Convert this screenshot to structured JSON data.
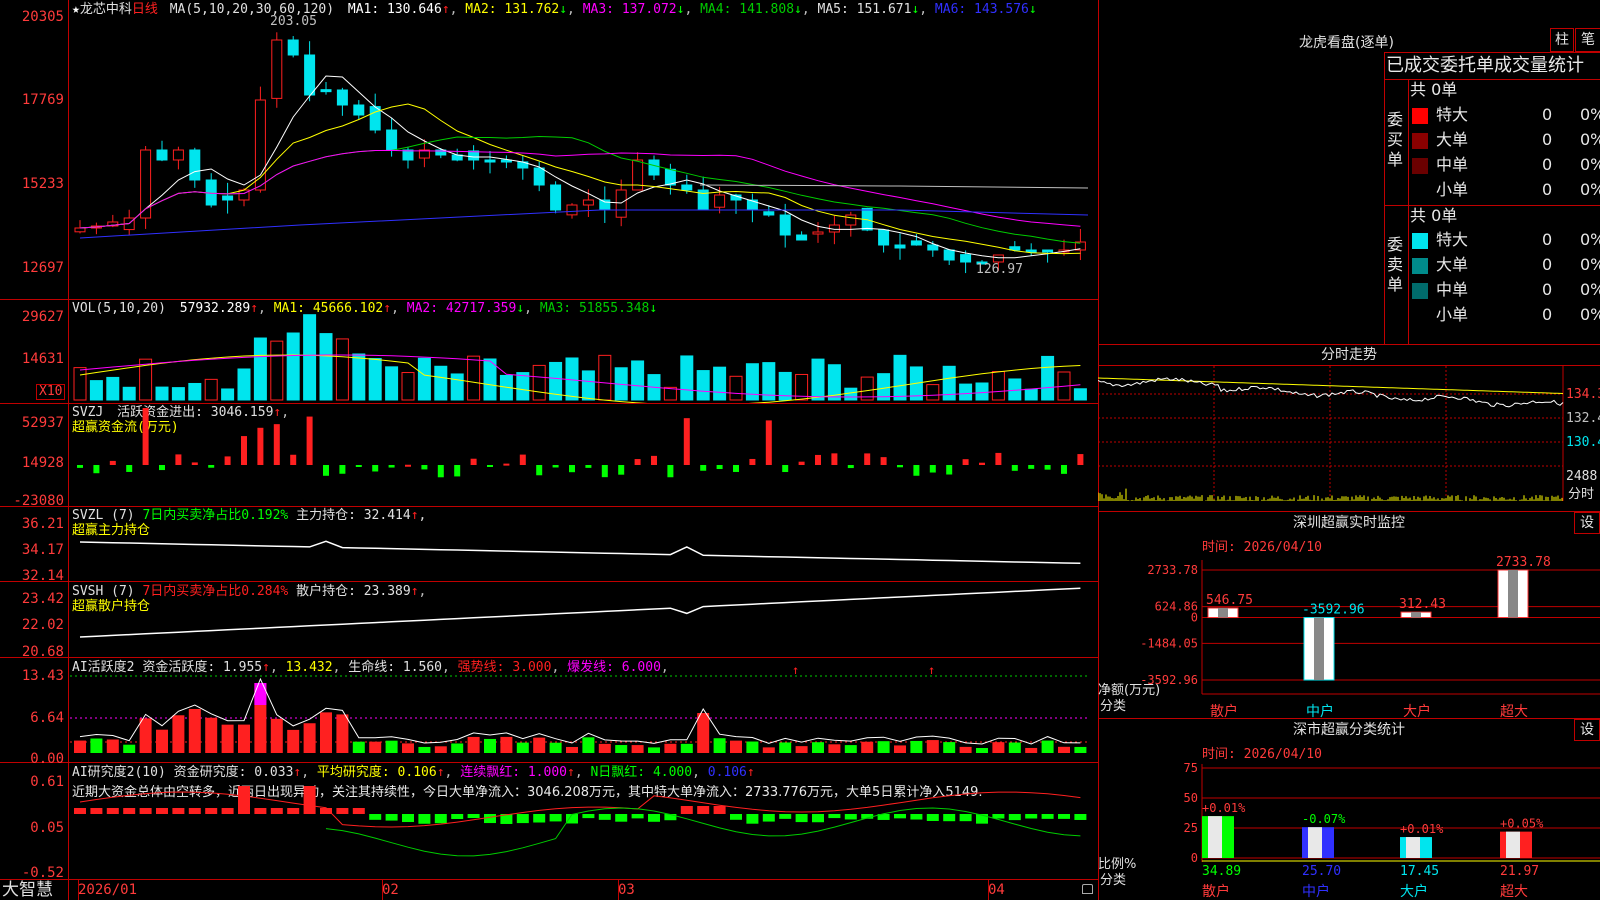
{
  "colors": {
    "up": "#ff2020",
    "down": "#00e5ee",
    "ma1": "#ffffff",
    "ma2": "#ffff00",
    "ma3": "#ff00ff",
    "ma4": "#00cc00",
    "ma5": "#c0c0c0",
    "ma6": "#3030ff",
    "green": "#00ff00",
    "frame": "#c00000"
  },
  "main": {
    "header": {
      "star": "★",
      "name": "龙芯中科",
      "period": "日线",
      "ma_params": "MA(5,10,20,30,60,120)",
      "ma1": "MA1: 130.646",
      "ma2": "MA2: 131.762",
      "ma3": "MA3: 137.072",
      "ma4": "MA4: 141.808",
      "ma5": "MA5: 151.671",
      "ma6": "MA6: 143.576",
      "up_arrow": "↑",
      "down_arrow": "↓"
    },
    "yticks": [
      "20305",
      "17769",
      "15233",
      "12697"
    ],
    "high_label": "203.05",
    "low_label": "126.97"
  },
  "vol": {
    "header": {
      "params": "VOL(5,10,20)",
      "value": "57932.289",
      "ma1": "MA1: 45666.102",
      "ma2": "MA2: 42717.359",
      "ma3": "MA3: 51855.348"
    },
    "yticks": [
      "29627",
      "14631"
    ],
    "unit": "X10"
  },
  "svzj": {
    "header": {
      "name": "SVZJ",
      "label": "活跃资金进出: 3046.159",
      "sub": "超赢资金流(万元)"
    },
    "yticks": [
      "52937",
      "14928",
      "-23080"
    ]
  },
  "svzl": {
    "header": {
      "name": "SVZL (7)",
      "ratio": "7日内买卖净占比0.192%",
      "label": "主力持仓: 32.414",
      "comma": ",",
      "sub": "超赢主力持仓"
    },
    "yticks": [
      "36.21",
      "34.17",
      "32.14"
    ]
  },
  "svsh": {
    "header": {
      "name": "SVSH (7)",
      "ratio": "7日内买卖净占比0.284%",
      "label": "散户持仓: 23.389",
      "sub": "超赢散户持仓"
    },
    "yticks": [
      "23.42",
      "22.02",
      "20.68"
    ]
  },
  "ai2": {
    "header": {
      "name": "AI活跃度2",
      "act": "资金活跃度: 1.955",
      "val2": "13.432",
      "life": "生命线: 1.560",
      "strong": "强势线: 3.000",
      "burst": "爆发线: 6.000"
    },
    "yticks": [
      "13.43",
      "6.64",
      "0.00"
    ]
  },
  "ai_res": {
    "header": {
      "name": "AI研究度2(10)",
      "res": "资金研究度: 0.033",
      "avg": "平均研究度: 0.106",
      "cont": "连续飘红: 1.000",
      "nday": "N日飘红: 4.000",
      "last": "0.106"
    },
    "comment": "近期大资金总体由空转多，近两日出现异动，关注其持续性，今日大单净流入：3046.208万元，其中特大单净流入：2733.776万元，大单5日累计净入5149.",
    "yticks": [
      "0.61",
      "0.05",
      "-0.52"
    ]
  },
  "xaxis": {
    "brand": "大智慧",
    "labels": [
      "2026/01",
      "02",
      "03",
      "04"
    ]
  },
  "right": {
    "lhb_title": "龙虎看盘(逐单)",
    "btn_zhu": "柱",
    "btn_bi": "笔",
    "stat_title": "已成交委托单成交量统计",
    "buy": {
      "side_label": "委买单",
      "total": "共 0单",
      "rows": [
        {
          "name": "特大",
          "qty": "0",
          "pct": "0%"
        },
        {
          "name": "大单",
          "qty": "0",
          "pct": "0%"
        },
        {
          "name": "中单",
          "qty": "0",
          "pct": "0%"
        },
        {
          "name": "小单",
          "qty": "0",
          "pct": "0%"
        }
      ]
    },
    "sell": {
      "side_label": "委卖单",
      "total": "共 0单",
      "rows": [
        {
          "name": "特大",
          "qty": "0",
          "pct": "0%"
        },
        {
          "name": "大单",
          "qty": "0",
          "pct": "0%"
        },
        {
          "name": "中单",
          "qty": "0",
          "pct": "0%"
        },
        {
          "name": "小单",
          "qty": "0",
          "pct": "0%"
        }
      ]
    },
    "intraday": {
      "title": "分时走势",
      "labels": [
        "134.3",
        "132.4",
        "130.4",
        "2488"
      ],
      "tab": "分时"
    },
    "sz_monitor": {
      "title": "深圳超赢实时监控",
      "btn": "设",
      "time": "时间: 2026/04/10",
      "yticks": [
        "2733.78",
        "624.86",
        "0",
        "-1484.05",
        "-3592.96"
      ],
      "ylabel": "净额(万元)",
      "xlabel": "分类",
      "cats": [
        "散户",
        "中户",
        "大户",
        "超大"
      ],
      "values": [
        546.75,
        -3592.96,
        312.43,
        2733.78
      ],
      "value_labels": [
        "546.75",
        "-3592.96",
        "312.43",
        "2733.78"
      ]
    },
    "sz_class": {
      "title": "深市超赢分类统计",
      "btn": "设",
      "time": "时间: 2026/04/10",
      "yticks": [
        "75",
        "50",
        "25",
        "0"
      ],
      "ylabel": "比例%",
      "xlabel": "分类",
      "cats": [
        "散户",
        "中户",
        "大户",
        "超大"
      ],
      "values": [
        34.89,
        25.7,
        17.45,
        21.97
      ],
      "value_labels": [
        "34.89",
        "25.70",
        "17.45",
        "21.97"
      ],
      "changes": [
        "+0.01%",
        "-0.07%",
        "+0.01%",
        "+0.05%"
      ]
    }
  }
}
